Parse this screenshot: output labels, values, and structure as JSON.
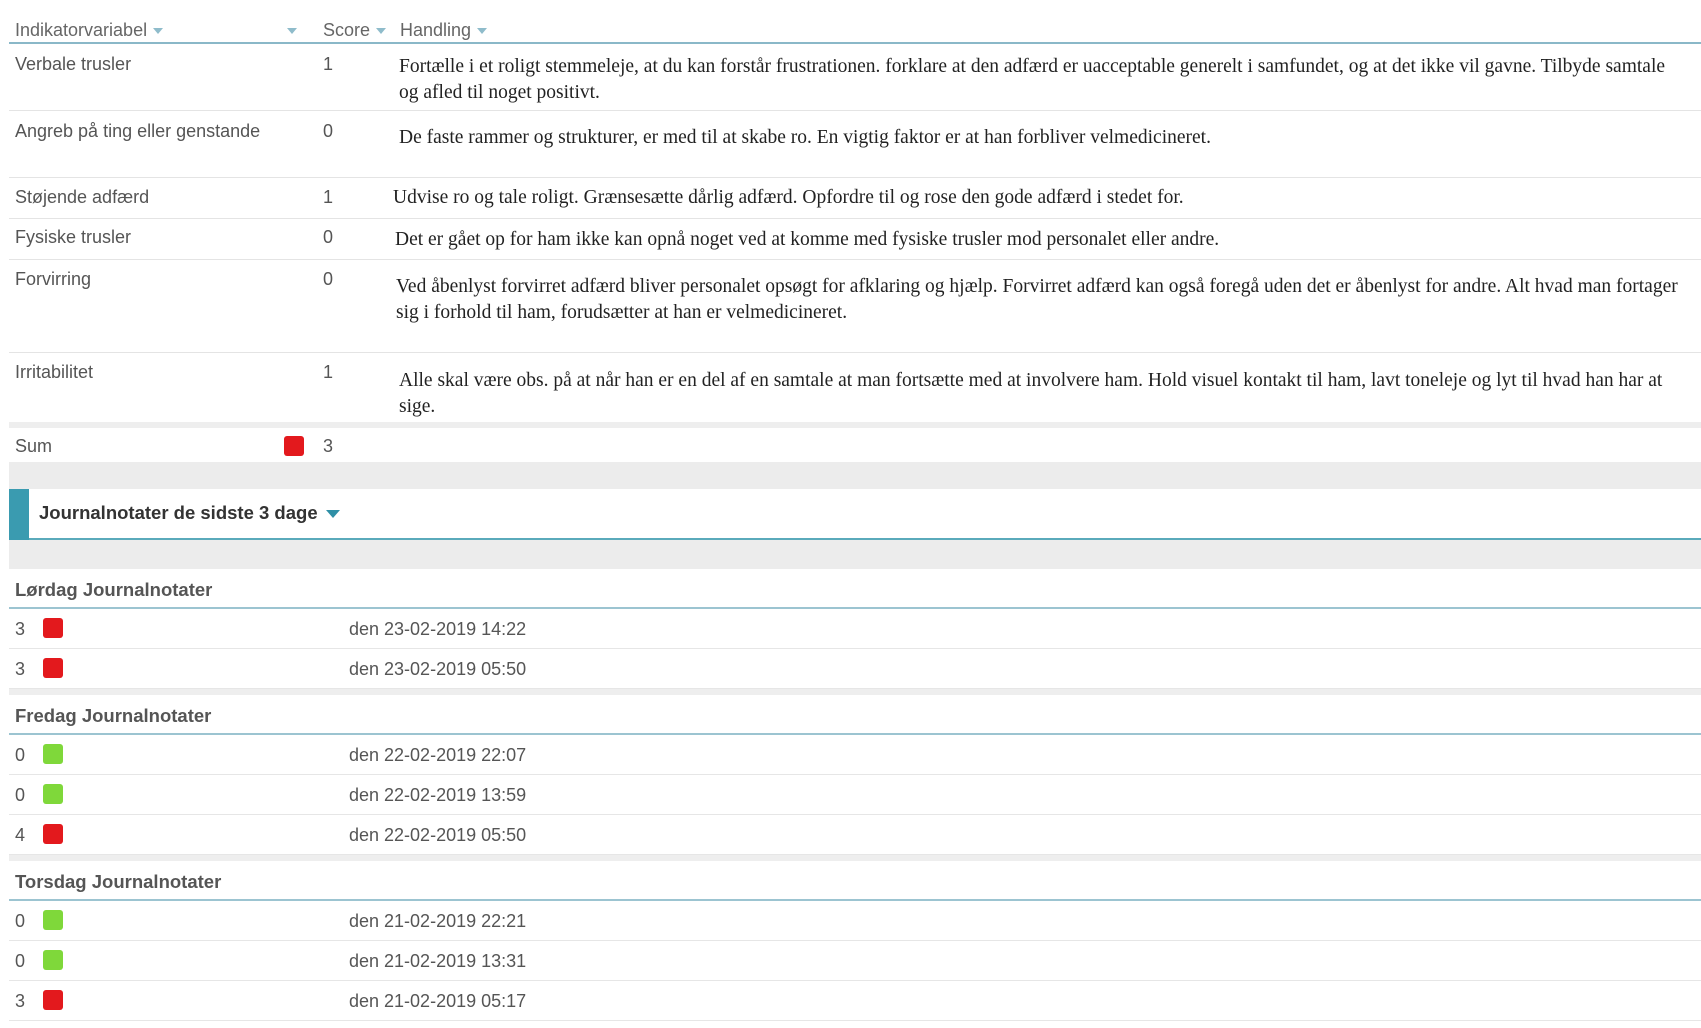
{
  "table": {
    "headers": {
      "indicator": "Indikatorvariabel",
      "score": "Score",
      "action": "Handling"
    },
    "rows": [
      {
        "label": "Verbale trusler",
        "score": "1",
        "action": "Fortælle i et roligt stemmeleje, at du kan forstår frustrationen. forklare at den adfærd er uacceptable generelt i samfundet, og at det ikke vil gavne. Tilbyde samtale og afled til noget positivt."
      },
      {
        "label": "Angreb på ting eller genstande",
        "score": "0",
        "action": "De faste rammer og strukturer, er med til at skabe ro. En vigtig faktor er at han forbliver velmedicineret."
      },
      {
        "label": "Støjende adfærd",
        "score": "1",
        "action": "Udvise ro og tale roligt. Grænsesætte dårlig adfærd. Opfordre til og rose den gode adfærd i stedet for."
      },
      {
        "label": "Fysiske trusler",
        "score": "0",
        "action": "Det er gået op for ham ikke kan opnå noget ved at komme med fysiske trusler mod personalet eller andre."
      },
      {
        "label": "Forvirring",
        "score": "0",
        "action": "Ved åbenlyst forvirret adfærd bliver personalet opsøgt for afklaring og hjælp. Forvirret adfærd kan også foregå uden det er åbenlyst for andre. Alt hvad man fortager sig i forhold til ham, forudsætter at han er velmedicineret."
      },
      {
        "label": "Irritabilitet",
        "score": "1",
        "action": "Alle skal være obs. på at når han er en del af en samtale at man fortsætte med at involvere ham. Hold visuel kontakt til ham, lavt toneleje og lyt til hvad han har at sige."
      }
    ],
    "sum": {
      "label": "Sum",
      "value": "3",
      "color": "#e3191d"
    }
  },
  "journal": {
    "title": "Journalnotater de sidste 3 dage",
    "days": [
      {
        "title": "Lørdag Journalnotater",
        "entries": [
          {
            "score": "3",
            "color": "#e3191d",
            "date": "den 23-02-2019 14:22"
          },
          {
            "score": "3",
            "color": "#e3191d",
            "date": "den 23-02-2019 05:50"
          }
        ]
      },
      {
        "title": "Fredag Journalnotater",
        "entries": [
          {
            "score": "0",
            "color": "#7fd83a",
            "date": "den 22-02-2019 22:07"
          },
          {
            "score": "0",
            "color": "#7fd83a",
            "date": "den 22-02-2019 13:59"
          },
          {
            "score": "4",
            "color": "#e3191d",
            "date": "den 22-02-2019 05:50"
          }
        ]
      },
      {
        "title": "Torsdag Journalnotater",
        "entries": [
          {
            "score": "0",
            "color": "#7fd83a",
            "date": "den 21-02-2019 22:21"
          },
          {
            "score": "0",
            "color": "#7fd83a",
            "date": "den 21-02-2019 13:31"
          },
          {
            "score": "3",
            "color": "#e3191d",
            "date": "den 21-02-2019 05:17"
          }
        ]
      }
    ]
  }
}
